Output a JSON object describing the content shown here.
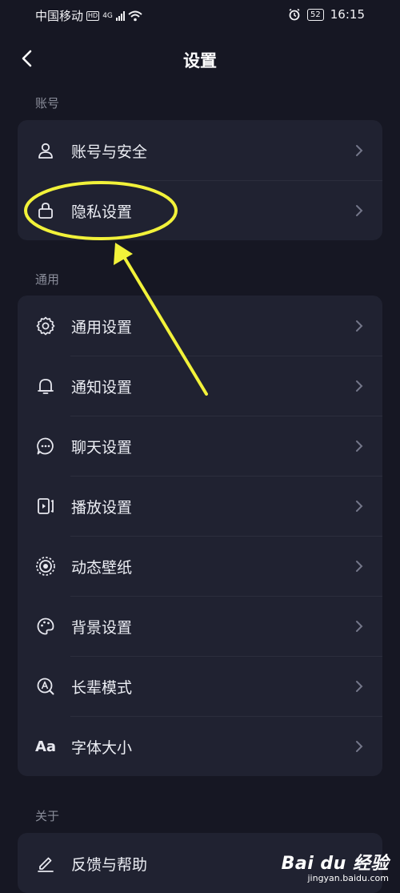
{
  "status": {
    "carrier": "中国移动",
    "hd": "HD",
    "signal": "4G",
    "battery": "52",
    "time": "16:15"
  },
  "header": {
    "title": "设置",
    "back_icon": "chevron-left-icon"
  },
  "sections": [
    {
      "label": "账号",
      "items": [
        {
          "label": "账号与安全",
          "icon": "user-icon"
        },
        {
          "label": "隐私设置",
          "icon": "lock-icon"
        }
      ]
    },
    {
      "label": "通用",
      "items": [
        {
          "label": "通用设置",
          "icon": "gear-icon"
        },
        {
          "label": "通知设置",
          "icon": "bell-icon"
        },
        {
          "label": "聊天设置",
          "icon": "chat-bubble-icon"
        },
        {
          "label": "播放设置",
          "icon": "play-settings-icon"
        },
        {
          "label": "动态壁纸",
          "icon": "live-wallpaper-icon"
        },
        {
          "label": "背景设置",
          "icon": "palette-icon"
        },
        {
          "label": "长辈模式",
          "icon": "elder-mode-icon"
        },
        {
          "label": "字体大小",
          "icon": "font-size-icon",
          "glyph": "Aa"
        }
      ]
    },
    {
      "label": "关于",
      "items": [
        {
          "label": "反馈与帮助",
          "icon": "edit-icon"
        }
      ]
    }
  ],
  "watermark": {
    "main": "Bai du 经验",
    "sub": "jingyan.baidu.com"
  },
  "colors": {
    "background": "#161723",
    "card": "#202231",
    "annotation": "#f2f23a"
  }
}
